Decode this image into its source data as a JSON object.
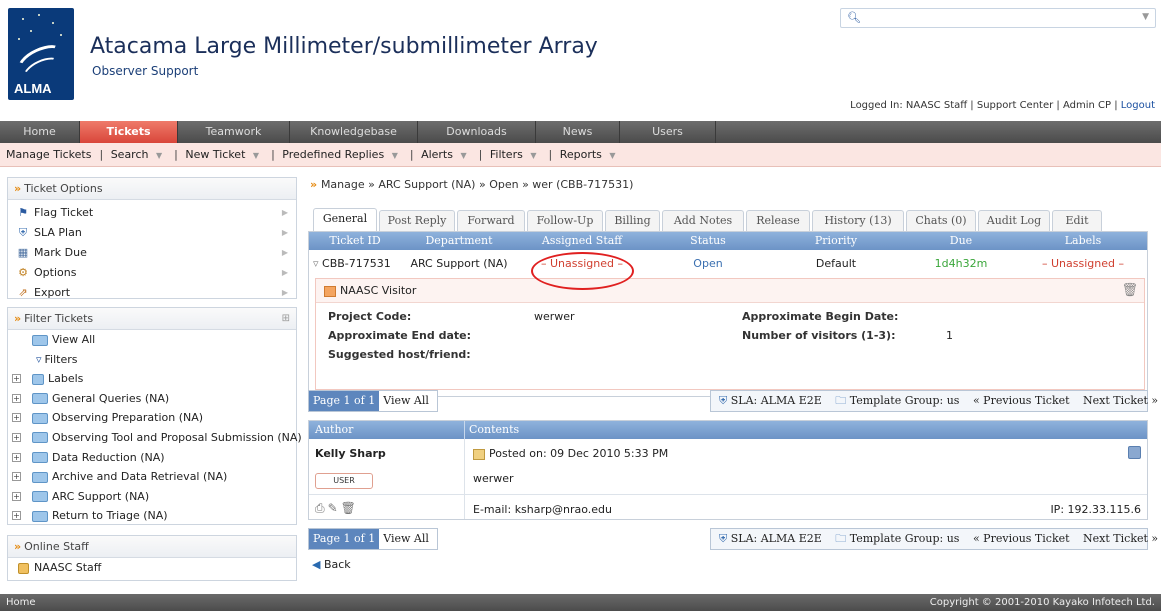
{
  "header": {
    "logo_text": "ALMA",
    "title": "Atacama Large Millimeter/submillimeter Array",
    "subtitle": "Observer Support",
    "login_text": "Logged In: NAASC Staff | Support Center | Admin CP | ",
    "logout": "Logout"
  },
  "search": {
    "placeholder": ""
  },
  "nav": [
    "Home",
    "Tickets",
    "Teamwork",
    "Knowledgebase",
    "Downloads",
    "News",
    "Users"
  ],
  "subnav": {
    "manage": "Manage Tickets",
    "search": "Search",
    "new_ticket": "New Ticket",
    "predefined": "Predefined Replies",
    "alerts": "Alerts",
    "filters": "Filters",
    "reports": "Reports"
  },
  "ticket_options": {
    "title": "Ticket Options",
    "items": [
      "Flag Ticket",
      "SLA Plan",
      "Mark Due",
      "Options",
      "Export"
    ]
  },
  "filter_tickets": {
    "title": "Filter Tickets",
    "items": [
      "View All",
      "Filters",
      "Labels",
      "General Queries (NA)",
      "Observing Preparation (NA)",
      "Observing Tool and Proposal Submission (NA)",
      "Data Reduction (NA)",
      "Archive and Data Retrieval (NA)",
      "ARC Support (NA)",
      "Return to Triage (NA)"
    ]
  },
  "online_staff": {
    "title": "Online Staff",
    "items": [
      "NAASC Staff"
    ]
  },
  "breadcrumb": "Manage » ARC Support (NA) » Open » wer (CBB-717531)",
  "ticket_tabs": [
    "General",
    "Post Reply",
    "Forward",
    "Follow-Up",
    "Billing",
    "Add Notes",
    "Release",
    "History (13)",
    "Chats (0)",
    "Audit Log",
    "Edit"
  ],
  "ticket": {
    "headers": [
      "Ticket ID",
      "Department",
      "Assigned Staff",
      "Status",
      "Priority",
      "Due",
      "Labels"
    ],
    "id": "CBB-717531",
    "department": "ARC Support (NA)",
    "assigned": "– Unassigned –",
    "status": "Open",
    "priority": "Default",
    "due": "1d4h32m",
    "labels": "– Unassigned –"
  },
  "visitor": {
    "title": "NAASC Visitor",
    "project_code_label": "Project Code:",
    "project_code": "werwer",
    "begin_label": "Approximate Begin Date:",
    "end_label": "Approximate End date:",
    "visitors_label": "Number of visitors (1-3):",
    "visitors": "1",
    "host_label": "Suggested host/friend:"
  },
  "pager": {
    "page": "Page 1 of 1",
    "view_all": "View All"
  },
  "sla_bar": {
    "sla": "SLA: ALMA E2E",
    "template": "Template Group: us",
    "prev": "« Previous Ticket",
    "next": "Next Ticket »"
  },
  "posts": {
    "headers": [
      "Author",
      "Contents"
    ],
    "author": "Kelly Sharp",
    "badge": "USER",
    "posted": "Posted on: 09 Dec 2010 5:33 PM",
    "body": "werwer",
    "email": "E-mail: ksharp@nrao.edu",
    "ip": "IP: 192.33.115.6"
  },
  "back": "Back",
  "footer": {
    "left": "Home",
    "right": "Copyright © 2001-2010 Kayako Infotech Ltd."
  },
  "colors": {
    "accent_red": "#d9463a",
    "link_blue": "#1a4fa0",
    "due_green": "#3aa63a"
  }
}
